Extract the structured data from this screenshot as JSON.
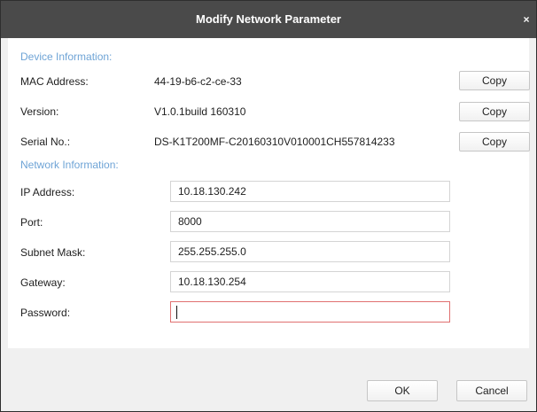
{
  "dialog": {
    "title": "Modify Network Parameter",
    "close_glyph": "×"
  },
  "device_info": {
    "section_label": "Device Information:",
    "mac": {
      "label": "MAC Address:",
      "value": "44-19-b6-c2-ce-33",
      "button": "Copy"
    },
    "version": {
      "label": "Version:",
      "value": "V1.0.1build 160310",
      "button": "Copy"
    },
    "serial": {
      "label": "Serial No.:",
      "value": "DS-K1T200MF-C20160310V010001CH557814233",
      "button": "Copy"
    }
  },
  "network_info": {
    "section_label": "Network Information:",
    "ip": {
      "label": "IP Address:",
      "value": "10.18.130.242"
    },
    "port": {
      "label": "Port:",
      "value": "8000"
    },
    "subnet": {
      "label": "Subnet Mask:",
      "value": "255.255.255.0"
    },
    "gateway": {
      "label": "Gateway:",
      "value": "10.18.130.254"
    },
    "password": {
      "label": "Password:",
      "value": ""
    }
  },
  "footer": {
    "ok_label": "OK",
    "cancel_label": "Cancel"
  },
  "colors": {
    "titlebar": "#4a4a4a",
    "section_label": "#6fa4d6",
    "active_field_border": "#e07070"
  }
}
